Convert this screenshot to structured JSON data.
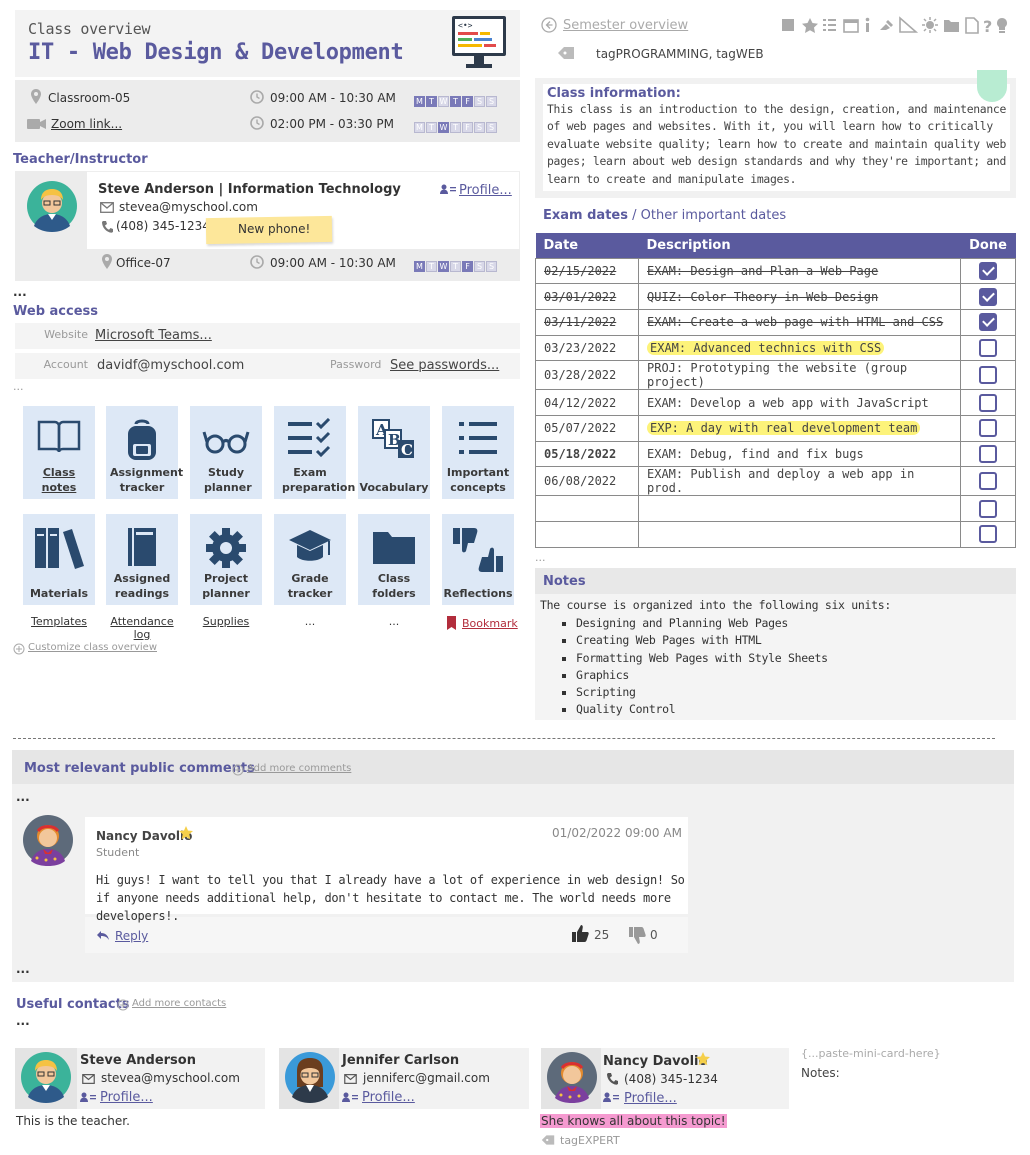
{
  "header": {
    "subtitle": "Class overview",
    "title": "IT - Web Design & Development",
    "location": "Classroom-05",
    "zoom_link": "Zoom link...",
    "time1": "09:00 AM - 10:30 AM",
    "time2": "02:00 PM - 03:30 PM",
    "days1": [
      "M",
      "T",
      "W",
      "T",
      "F",
      "S",
      "S"
    ],
    "days1_on": [
      1,
      1,
      0,
      1,
      1,
      0,
      0
    ],
    "days2": [
      "M",
      "T",
      "W",
      "T",
      "F",
      "S",
      "S"
    ],
    "days2_on": [
      0,
      0,
      1,
      0,
      0,
      0,
      0
    ]
  },
  "teacher": {
    "section": "Teacher/Instructor",
    "name": "Steve Anderson | Information Technology",
    "email": "stevea@myschool.com",
    "phone": "(408) 345-1234",
    "sticky": "New phone!",
    "profile": "Profile...",
    "office": "Office-07",
    "office_time": "09:00 AM - 10:30 AM",
    "days": [
      "M",
      "T",
      "W",
      "T",
      "F",
      "S",
      "S"
    ]
  },
  "ellipsis": "...",
  "web_access": {
    "section": "Web access",
    "website_label": "Website",
    "website_value": "Microsoft Teams...",
    "account_label": "Account",
    "account_value": "davidf@myschool.com",
    "password_label": "Password",
    "password_value": "See passwords..."
  },
  "tiles": [
    {
      "label": "Class notes",
      "icon": "book-icon"
    },
    {
      "label": "Assignment tracker",
      "icon": "backpack-icon"
    },
    {
      "label": "Study planner",
      "icon": "glasses-icon"
    },
    {
      "label": "Exam preparation",
      "icon": "checklist-icon"
    },
    {
      "label": "Vocabulary",
      "icon": "abc-icon"
    },
    {
      "label": "Important concepts",
      "icon": "list-icon"
    },
    {
      "label": "Materials",
      "icon": "books-icon"
    },
    {
      "label": "Assigned readings",
      "icon": "notebook-icon"
    },
    {
      "label": "Project planner",
      "icon": "gear-icon"
    },
    {
      "label": "Grade tracker",
      "icon": "graduation-cap-icon"
    },
    {
      "label": "Class folders",
      "icon": "folder-icon"
    },
    {
      "label": "Reflections",
      "icon": "thumbs-icon"
    }
  ],
  "tile_links": [
    "Templates",
    "Attendance log",
    "Supplies",
    "...",
    "...",
    "Bookmark"
  ],
  "customize": "Customize class overview",
  "topnav": {
    "semester": "Semester overview",
    "tags": "tagPROGRAMMING, tagWEB"
  },
  "class_info": {
    "title": "Class information:",
    "text": "This class is an introduction to the design, creation, and maintenance of web pages and websites. With it, you will learn how to critically evaluate website quality; learn how to create and maintain quality web pages; learn about web design standards and why they're important; and learn to create and manipulate images."
  },
  "exam": {
    "title_main": "Exam dates",
    "title_sep": " / ",
    "title_other": "Other important dates",
    "headers": [
      "Date",
      "Description",
      "Done"
    ],
    "rows": [
      {
        "date": "02/15/2022",
        "desc": "EXAM: Design and Plan a Web Page",
        "done": true
      },
      {
        "date": "03/01/2022",
        "desc": "QUIZ: Color Theory in Web Design",
        "done": true
      },
      {
        "date": "03/11/2022",
        "desc": "EXAM: Create a web page with HTML and CSS",
        "done": true
      },
      {
        "date": "03/23/2022",
        "desc": "EXAM: Advanced technics with CSS",
        "done": false
      },
      {
        "date": "03/28/2022",
        "desc": "PROJ: Prototyping the website (group project)",
        "done": false
      },
      {
        "date": "04/12/2022",
        "desc": "EXAM: Develop a web app with JavaScript",
        "done": false
      },
      {
        "date": "05/07/2022",
        "desc": "EXP: A day with real development team",
        "done": false
      },
      {
        "date": "05/18/2022",
        "desc": "EXAM: Debug, find and fix bugs",
        "done": false
      },
      {
        "date": "06/08/2022",
        "desc": "EXAM: Publish and deploy a web app in prod.",
        "done": false
      },
      {
        "date": "",
        "desc": "",
        "done": false
      },
      {
        "date": "",
        "desc": "",
        "done": false
      }
    ]
  },
  "notes": {
    "title": "Notes",
    "intro": "The course is organized into the following six units:",
    "items": [
      "Designing and Planning Web Pages",
      "Creating Web Pages with HTML",
      "Formatting Web Pages with Style Sheets",
      "Graphics",
      "Scripting",
      "Quality Control"
    ]
  },
  "comments": {
    "title": "Most relevant public comments",
    "add": "Add more comments",
    "name": "Nancy Davolio",
    "role": "Student",
    "date": "01/02/2022 09:00 AM",
    "text": "Hi guys! I want to tell you that I already have a lot of experience in web design! So if anyone needs additional help, don't hesitate to contact me. The world needs more developers!.",
    "reply": "Reply",
    "likes": "25",
    "dislikes": "0"
  },
  "contacts": {
    "title": "Useful contacts",
    "add": "Add more contacts",
    "c1": {
      "name": "Steve Anderson",
      "email": "stevea@myschool.com",
      "profile": "Profile...",
      "note": "This is the teacher."
    },
    "c2": {
      "name": "Jennifer Carlson",
      "email": "jenniferc@gmail.com",
      "profile": "Profile..."
    },
    "c3": {
      "name": "Nancy Davolio",
      "phone": "(408) 345-1234",
      "profile": "Profile...",
      "note": "She knows all about this topic!",
      "tag": "tagEXPERT"
    },
    "paste": "{...paste-mini-card-here}",
    "notes_label": "Notes:"
  }
}
